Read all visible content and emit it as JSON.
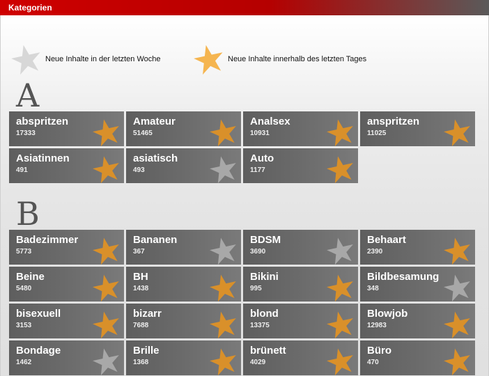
{
  "header": {
    "title": "Kategorien"
  },
  "legend": {
    "week_label": "Neue Inhalte in der letzten Woche",
    "day_label": "Neue Inhalte innerhalb des letzten Tages"
  },
  "colors": {
    "star_day": "#d9902a",
    "star_week": "#a8a8a8",
    "legend_star_week": "#d7d7d7",
    "legend_star_day": "#f5b550"
  },
  "sections": [
    {
      "letter": "A",
      "items": [
        {
          "name": "abspritzen",
          "count": "17333",
          "star": "day"
        },
        {
          "name": "Amateur",
          "count": "51465",
          "star": "day"
        },
        {
          "name": "Analsex",
          "count": "10931",
          "star": "day"
        },
        {
          "name": "anspritzen",
          "count": "11025",
          "star": "day"
        },
        {
          "name": "Asiatinnen",
          "count": "491",
          "star": "day"
        },
        {
          "name": "asiatisch",
          "count": "493",
          "star": "week"
        },
        {
          "name": "Auto",
          "count": "1177",
          "star": "day"
        }
      ]
    },
    {
      "letter": "B",
      "items": [
        {
          "name": "Badezimmer",
          "count": "5773",
          "star": "day"
        },
        {
          "name": "Bananen",
          "count": "367",
          "star": "week"
        },
        {
          "name": "BDSM",
          "count": "3690",
          "star": "week"
        },
        {
          "name": "Behaart",
          "count": "2390",
          "star": "day"
        },
        {
          "name": "Beine",
          "count": "5480",
          "star": "day"
        },
        {
          "name": "BH",
          "count": "1438",
          "star": "day"
        },
        {
          "name": "Bikini",
          "count": "995",
          "star": "day"
        },
        {
          "name": "Bildbesamung",
          "count": "348",
          "star": "week"
        },
        {
          "name": "bisexuell",
          "count": "3153",
          "star": "day"
        },
        {
          "name": "bizarr",
          "count": "7688",
          "star": "day"
        },
        {
          "name": "blond",
          "count": "13375",
          "star": "day"
        },
        {
          "name": "Blowjob",
          "count": "12983",
          "star": "day"
        },
        {
          "name": "Bondage",
          "count": "1462",
          "star": "week"
        },
        {
          "name": "Brille",
          "count": "1368",
          "star": "day"
        },
        {
          "name": "brünett",
          "count": "4029",
          "star": "day"
        },
        {
          "name": "Büro",
          "count": "470",
          "star": "day"
        }
      ]
    }
  ]
}
